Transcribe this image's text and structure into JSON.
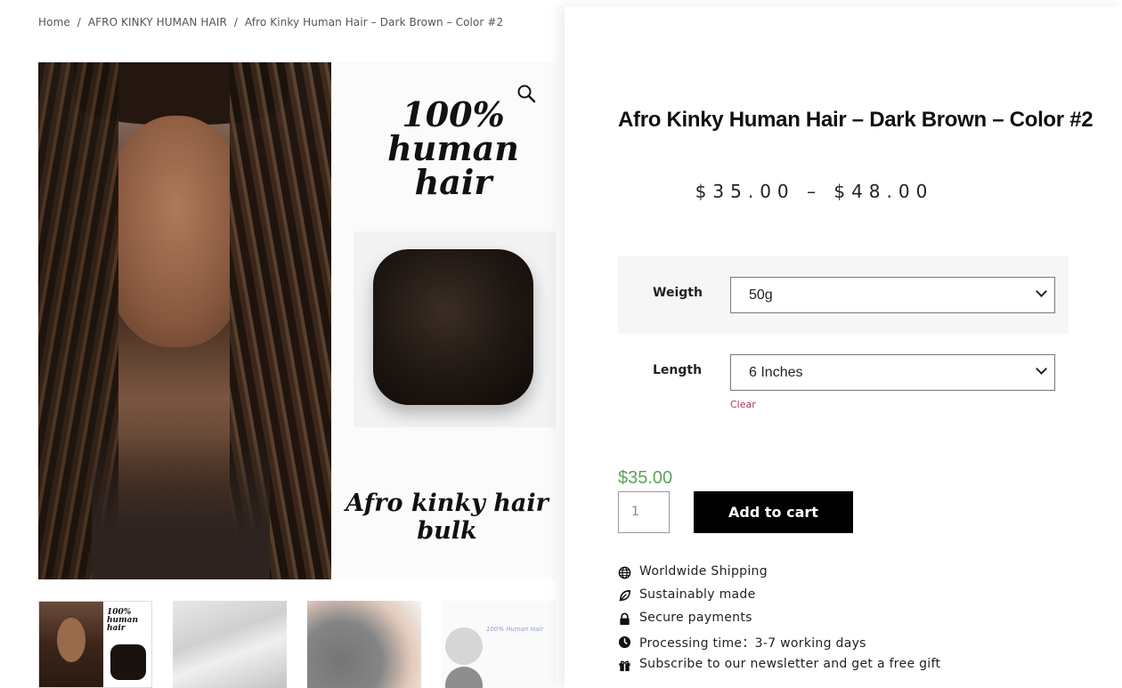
{
  "breadcrumb": {
    "home": "Home",
    "sep1": "/",
    "category": "AFRO KINKY HUMAN HAIR",
    "sep2": "/",
    "current": "Afro Kinky Human Hair – Dark Brown – Color #2"
  },
  "gallery": {
    "tagline_top": "100% human hair",
    "tagline_bottom": "Afro kinky hair bulk",
    "thumb1_text": "100% human hair",
    "thumb4_text": "100% Human Hair"
  },
  "product": {
    "title": "Afro Kinky Human Hair – Dark Brown – Color #2",
    "price_range": "$35.00 – $48.00",
    "current_price": "$35.00",
    "quantity": "1",
    "add_to_cart": "Add to cart"
  },
  "variations": {
    "weight_label": "Weigth",
    "weight_value": "50g",
    "length_label": "Length",
    "length_value": "6 Inches",
    "clear": "Clear"
  },
  "features": [
    {
      "icon": "globe-icon",
      "text": "Worldwide Shipping"
    },
    {
      "icon": "leaf-icon",
      "text": "Sustainably made"
    },
    {
      "icon": "lock-icon",
      "text": "Secure payments"
    },
    {
      "icon": "clock-icon",
      "text": "Processing time：3-7 working days"
    },
    {
      "icon": "gift-icon",
      "text": "Subscribe to our newsletter and get a free gift"
    }
  ],
  "colors": {
    "price_green": "#5ea15a",
    "clear_link": "#b0336a",
    "button_bg": "#000000"
  }
}
